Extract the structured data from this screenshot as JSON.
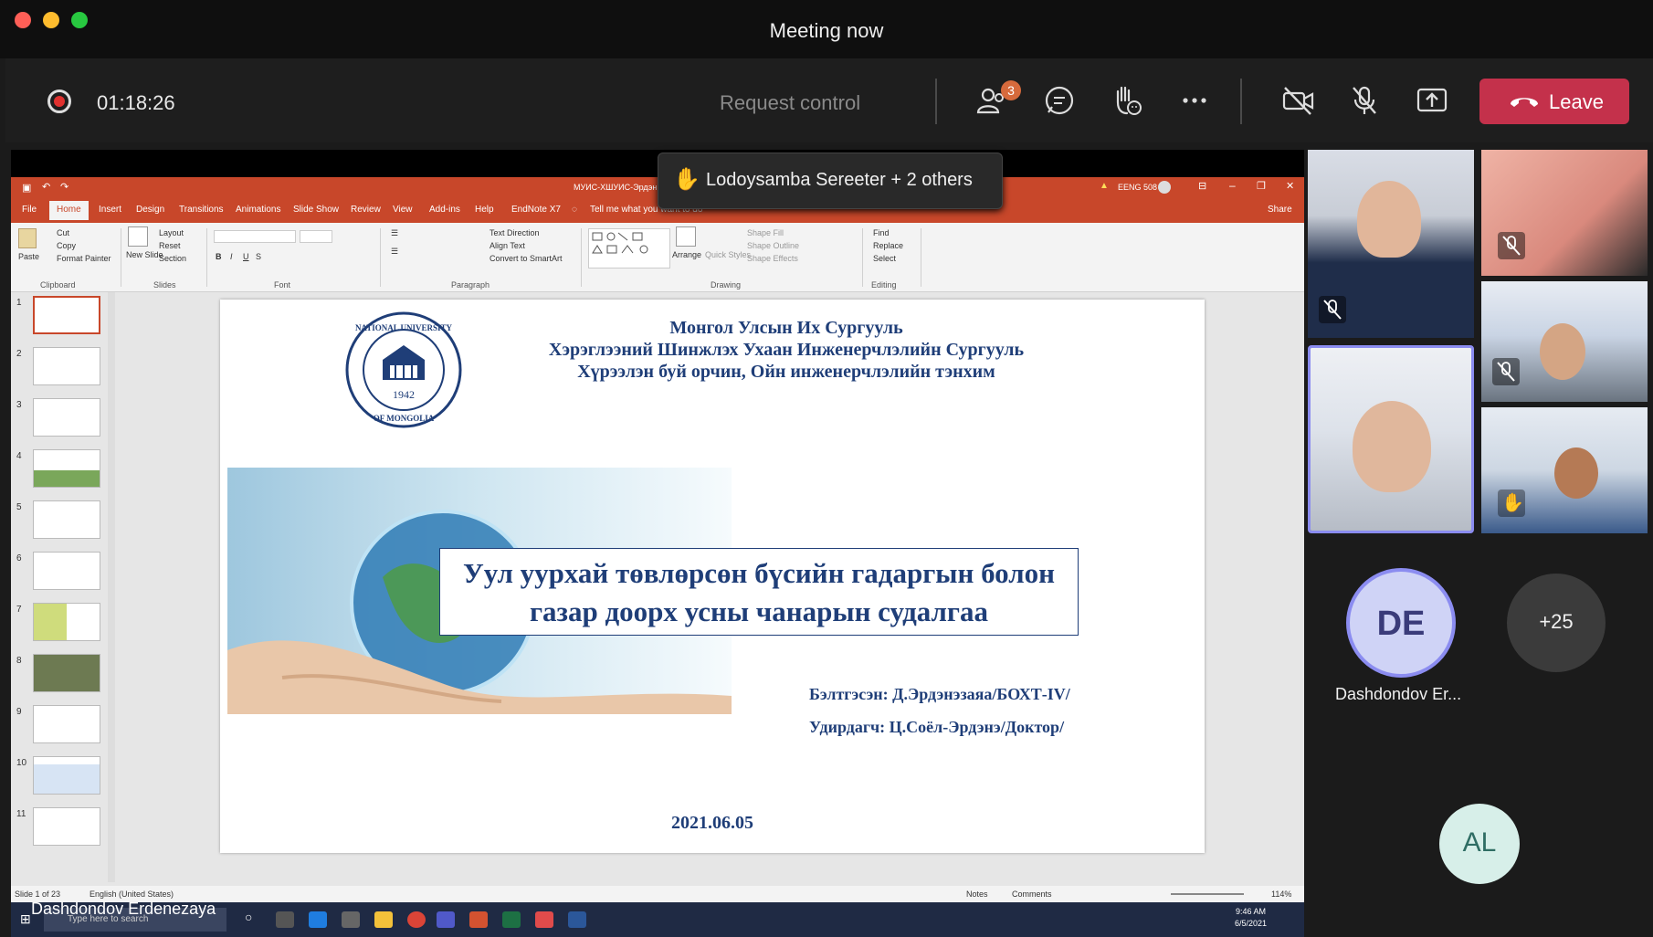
{
  "window": {
    "title": "Meeting now"
  },
  "controls": {
    "timer": "01:18:26",
    "request_control": "Request control",
    "participants_badge": "3",
    "leave_label": "Leave"
  },
  "raise_hand_toast": {
    "text": "Lodoysamba Sereeter + 2 others"
  },
  "powerpoint": {
    "doc_title": "МУИС-ХШУИС-Эрдэн",
    "course": "EENG 508",
    "share": "Share",
    "tabs": [
      "File",
      "Home",
      "Insert",
      "Design",
      "Transitions",
      "Animations",
      "Slide Show",
      "Review",
      "View",
      "Add-ins",
      "Help",
      "EndNote X7"
    ],
    "tell_me": "Tell me what you want to do",
    "ribbon": {
      "cut": "Cut",
      "copy": "Copy",
      "format_painter": "Format Painter",
      "paste": "Paste",
      "new_slide": "New Slide",
      "layout": "Layout",
      "reset": "Reset",
      "section": "Section",
      "text_direction": "Text Direction",
      "align_text": "Align Text",
      "convert_smartart": "Convert to SmartArt",
      "arrange": "Arrange",
      "quick_styles": "Quick Styles",
      "shape_fill": "Shape Fill",
      "shape_outline": "Shape Outline",
      "shape_effects": "Shape Effects",
      "find": "Find",
      "replace": "Replace",
      "select": "Select",
      "groups": [
        "Clipboard",
        "Slides",
        "Font",
        "Paragraph",
        "Drawing",
        "Editing"
      ]
    },
    "thumb_numbers": [
      "1",
      "2",
      "3",
      "4",
      "5",
      "6",
      "7",
      "8",
      "9",
      "10",
      "11"
    ],
    "slide": {
      "logo_year": "1942",
      "logo_text_top": "NATIONAL UNIVERSITY",
      "logo_text_bottom": "OF MONGOLIA",
      "heading1": "Монгол Улсын Их Сургууль",
      "heading2": "Хэрэглээний Шинжлэх Ухаан Инженерчлэлийн Сургууль",
      "heading3": "Хүрээлэн буй орчин, Ойн инженерчлэлийн тэнхим",
      "title_line1": "Уул уурхай төвлөрсөн бүсийн гадаргын болон",
      "title_line2": "газар доорх усны чанарын судалгаа",
      "prepared_by": "Бэлтгэсэн: Д.Эрдэнэзаяа/БОХТ-IV/",
      "supervisor": "Удирдагч: Ц.Соёл-Эрдэнэ/Доктор/",
      "date": "2021.06.05"
    },
    "status": {
      "slide_of": "Slide 1 of 23",
      "language": "English (United States)",
      "notes": "Notes",
      "comments": "Comments",
      "zoom": "114%"
    },
    "taskbar": {
      "search": "Type here to search",
      "time": "9:46 AM",
      "date": "6/5/2021"
    }
  },
  "presenter_name": "Dashdondov Erdenezaya",
  "participants": {
    "de_initials": "DE",
    "de_name": "Dashdondov Er...",
    "more_count": "+25",
    "al_initials": "AL"
  },
  "colors": {
    "leave": "#c4314b",
    "ppt_accent": "#c8472a",
    "active_speaker": "#8b8cf0",
    "slide_text": "#1f3e78"
  }
}
